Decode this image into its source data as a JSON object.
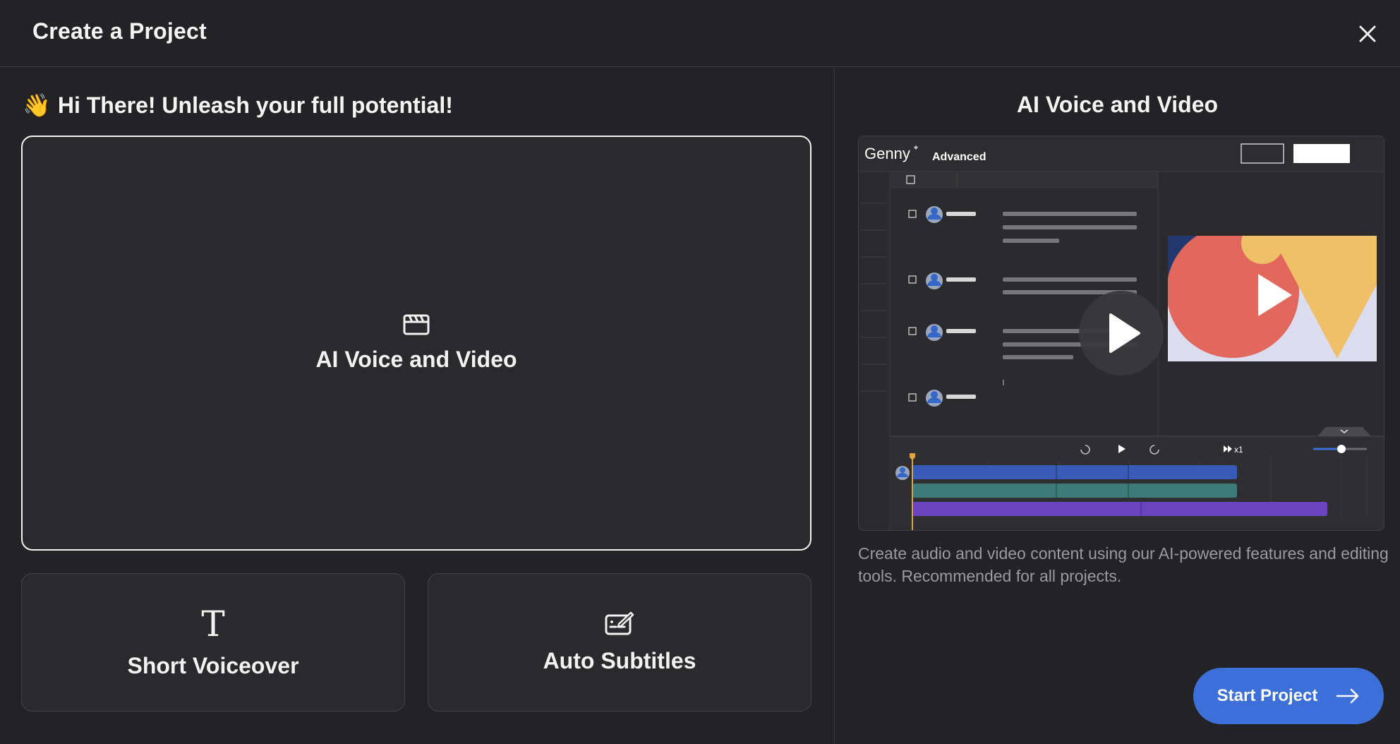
{
  "header": {
    "title": "Create a Project"
  },
  "main": {
    "greeting_emoji": "👋",
    "greeting": "Hi There! Unleash your full potential!",
    "options": [
      {
        "label": "AI Voice and Video",
        "icon": "clapperboard-icon",
        "selected": true
      },
      {
        "label": "Short Voiceover",
        "icon": "text-t-icon",
        "selected": false
      },
      {
        "label": "Auto Subtitles",
        "icon": "subtitles-edit-icon",
        "selected": false
      }
    ]
  },
  "preview_panel": {
    "title": "AI Voice and Video",
    "preview": {
      "logo_text": "Genny",
      "mode_label": "Advanced",
      "speed_label": "x1"
    },
    "description": "Create audio and video content using our AI-powered features and editing tools. Recommended for all projects.",
    "start_button_label": "Start Project"
  },
  "colors": {
    "background": "#232326",
    "card": "#2a2a2d",
    "accent": "#3d6fd8",
    "timeline_blue": "#3a5ab8",
    "timeline_teal": "#3d7b78",
    "timeline_purple": "#6b44c2"
  }
}
